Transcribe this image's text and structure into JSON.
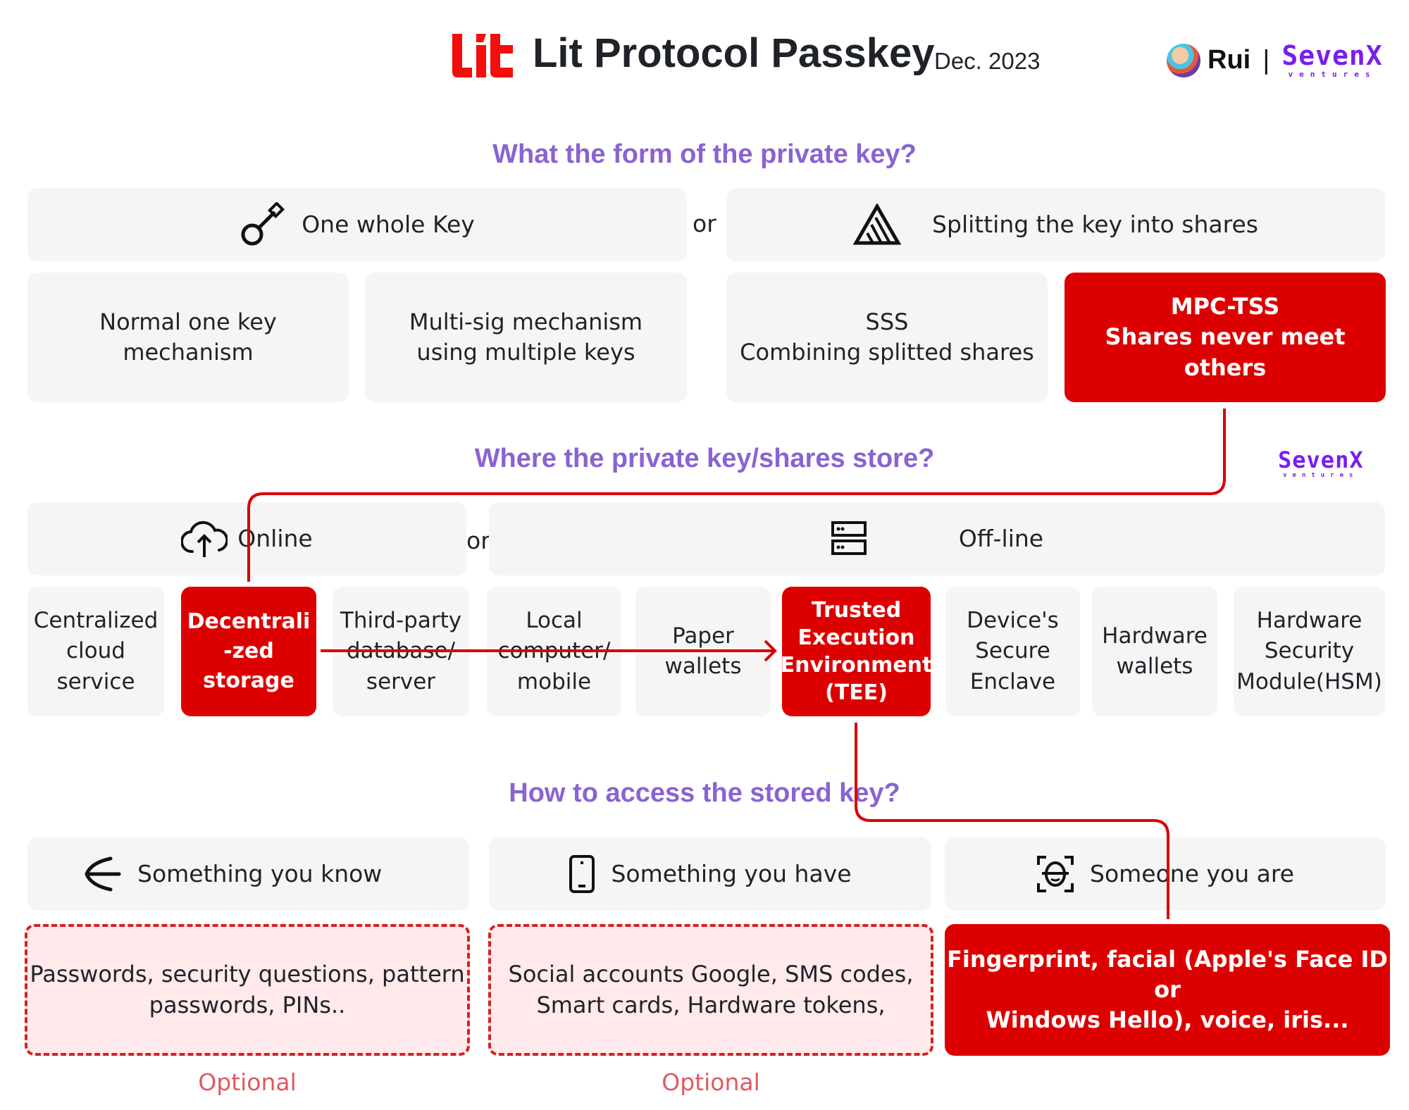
{
  "header": {
    "logo_text": "Lit",
    "title": "Lit Protocol Passkey",
    "date": "Dec. 2023",
    "author_name": "Rui",
    "separator": "|",
    "brand_line1": "SevenX",
    "brand_line2": "ventures"
  },
  "colors": {
    "accent_red": "#dd0000",
    "heading_purple": "#8a63d2",
    "box_gray": "#f5f5f5",
    "optional_pink": "#ffe9ea",
    "brand_purple": "#7a1df0"
  },
  "section1": {
    "heading": "What the form of the private key?",
    "or_label": "or",
    "categories": [
      {
        "label": "One whole Key",
        "icon": "key-icon"
      },
      {
        "label": "Splitting the key into shares",
        "icon": "split-triangle-icon"
      }
    ],
    "options": [
      {
        "line1": "Normal one key",
        "line2": "mechanism",
        "highlighted": false
      },
      {
        "line1": "Multi-sig mechanism",
        "line2": "using multiple keys",
        "highlighted": false
      },
      {
        "line1": "SSS",
        "line2": "Combining splitted shares",
        "highlighted": false
      },
      {
        "line1": "MPC-TSS",
        "line2": "Shares never meet others",
        "highlighted": true
      }
    ]
  },
  "section2": {
    "heading": "Where the private key/shares store?",
    "or_label": "or",
    "watermark_line1": "SevenX",
    "watermark_line2": "ventures",
    "categories": [
      {
        "label": "Online",
        "icon": "cloud-upload-icon"
      },
      {
        "label": "Off-line",
        "icon": "server-icon"
      }
    ],
    "options": [
      {
        "lines": [
          "Centralized",
          "cloud",
          "service"
        ],
        "highlighted": false
      },
      {
        "lines": [
          "Decentrali",
          "-zed",
          "storage"
        ],
        "highlighted": true
      },
      {
        "lines": [
          "Third-party",
          "database/",
          "server"
        ],
        "highlighted": false
      },
      {
        "lines": [
          "Local",
          "computer/",
          "mobile"
        ],
        "highlighted": false
      },
      {
        "lines": [
          "Paper",
          "wallets"
        ],
        "highlighted": false
      },
      {
        "lines": [
          "Trusted",
          "Execution",
          "Environment",
          "(TEE)"
        ],
        "highlighted": true
      },
      {
        "lines": [
          "Device's",
          "Secure",
          "Enclave"
        ],
        "highlighted": false
      },
      {
        "lines": [
          "Hardware",
          "wallets"
        ],
        "highlighted": false
      },
      {
        "lines": [
          "Hardware",
          "Security",
          "Module(HSM)"
        ],
        "highlighted": false
      }
    ]
  },
  "section3": {
    "heading": "How to access the stored key?",
    "categories": [
      {
        "label": "Something you know",
        "icon": "arrow-left-icon"
      },
      {
        "label": "Something you have",
        "icon": "phone-icon"
      },
      {
        "label": "Someone you are",
        "icon": "face-scan-icon"
      }
    ],
    "options": [
      {
        "line1": "Passwords, security questions, pattern",
        "line2": "passwords, PINs..",
        "style": "optional"
      },
      {
        "line1": "Social accounts Google, SMS codes,",
        "line2": "Smart cards, Hardware tokens,",
        "style": "optional"
      },
      {
        "line1": "Fingerprint, facial (Apple's Face ID or",
        "line2": "Windows Hello), voice, iris...",
        "style": "highlighted"
      }
    ],
    "optional_label": "Optional"
  }
}
